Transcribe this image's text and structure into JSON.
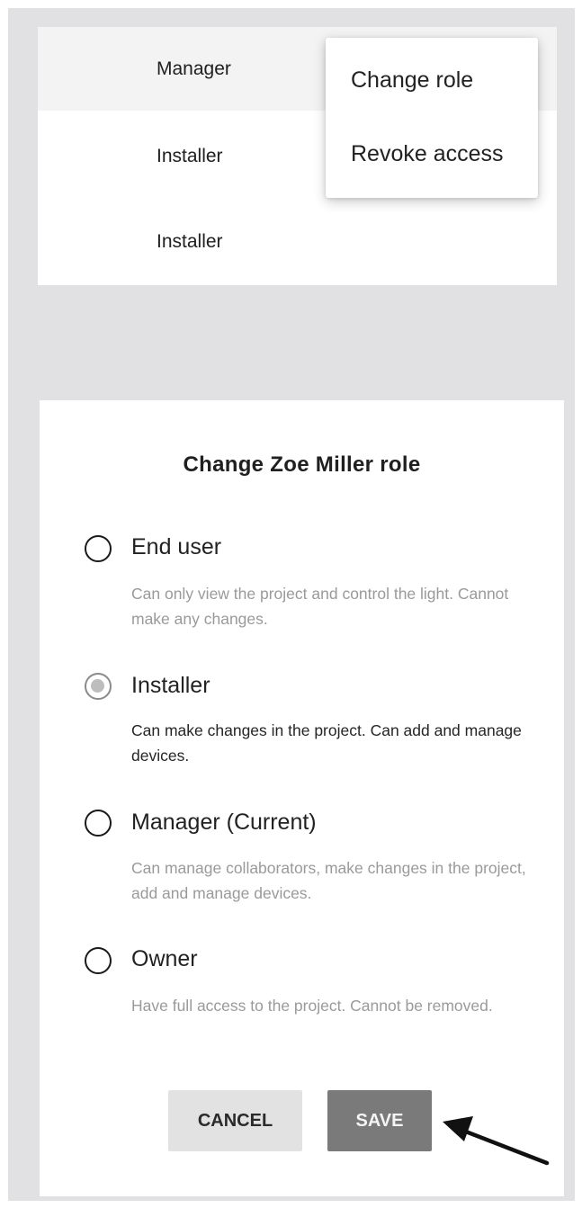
{
  "collaborators": {
    "rows": [
      {
        "role": "Manager"
      },
      {
        "role": "Installer"
      },
      {
        "role": "Installer"
      }
    ]
  },
  "context_menu": {
    "items": [
      "Change role",
      "Revoke access"
    ]
  },
  "dialog": {
    "title": "Change Zoe Miller role",
    "selected": "Installer",
    "options": [
      {
        "label": "End user",
        "description": "Can only view the project and control the light. Cannot make any changes."
      },
      {
        "label": "Installer",
        "description": "Can make changes in the project. Can add and manage devices."
      },
      {
        "label": "Manager (Current)",
        "description": "Can manage collaborators, make changes in the project, add and manage devices."
      },
      {
        "label": "Owner",
        "description": "Have full access to the project. Cannot be removed."
      }
    ],
    "cancel_label": "CANCEL",
    "save_label": "SAVE"
  },
  "annotation": {
    "icon": "arrow-pointer-icon",
    "color": "#111111"
  }
}
